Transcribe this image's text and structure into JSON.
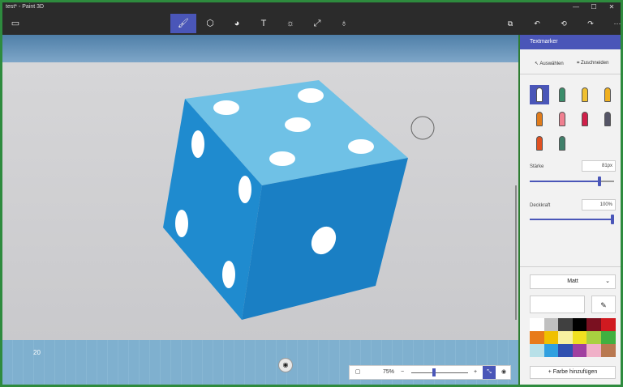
{
  "window": {
    "title": "test* - Paint 3D",
    "minimize": "—",
    "maximize": "☐",
    "close": "✕"
  },
  "toolbar": {
    "menu_icon": "folder-icon",
    "tools": [
      {
        "name": "brushes-tool",
        "glyph": "🖌",
        "active": true
      },
      {
        "name": "3d-shapes-tool",
        "glyph": "⬡"
      },
      {
        "name": "stickers-tool",
        "glyph": "◕"
      },
      {
        "name": "text-tool",
        "glyph": "T"
      },
      {
        "name": "effects-tool",
        "glyph": "☼"
      },
      {
        "name": "canvas-tool",
        "glyph": "⤢"
      },
      {
        "name": "remix3d-tool",
        "glyph": "♁"
      }
    ],
    "right": [
      {
        "name": "paste-icon",
        "glyph": "⧉"
      },
      {
        "name": "undo-icon",
        "glyph": "↶"
      },
      {
        "name": "history-icon",
        "glyph": "⟲"
      },
      {
        "name": "redo-icon",
        "glyph": "↷"
      },
      {
        "name": "more-icon",
        "glyph": "···"
      }
    ]
  },
  "canvas": {
    "counter": "20",
    "zoom": "75%",
    "zoom_level": 0.37
  },
  "panel": {
    "title": "Textmarker",
    "select_label": "Auswählen",
    "crop_label": "Zuschneiden",
    "brushes": [
      {
        "name": "marker-brush",
        "color": "#ffffff",
        "active": true
      },
      {
        "name": "calligraphy-pen-brush",
        "color": "#3a8d6a"
      },
      {
        "name": "oil-brush",
        "color": "#f0c030"
      },
      {
        "name": "watercolor-brush",
        "color": "#f0b020"
      },
      {
        "name": "pencil-brush",
        "color": "#e07b1b"
      },
      {
        "name": "eraser-brush",
        "color": "#f08090"
      },
      {
        "name": "crayon-brush",
        "color": "#d0204a"
      },
      {
        "name": "pixel-pen-brush",
        "color": "#555566"
      },
      {
        "name": "spray-can-brush",
        "color": "#e05020"
      },
      {
        "name": "fill-brush",
        "color": "#40806a"
      }
    ],
    "thickness_label": "Stärke",
    "thickness_value": "81px",
    "thickness_level": 0.81,
    "opacity_label": "Deckkraft",
    "opacity_value": "100%",
    "opacity_level": 1.0,
    "finish": "Matt",
    "add_color": "+ Farbe hinzufügen",
    "palette": [
      "#ffffff",
      "#c0c0c0",
      "#404040",
      "#000000",
      "#7a1020",
      "#d01a20",
      "#e87b1a",
      "#f0c000",
      "#f8f0a0",
      "#f0e020",
      "#a8d040",
      "#40b040",
      "#b8e0e8",
      "#30a0e0",
      "#3050b0",
      "#a040a0",
      "#f0b0c8",
      "#b87850"
    ]
  }
}
